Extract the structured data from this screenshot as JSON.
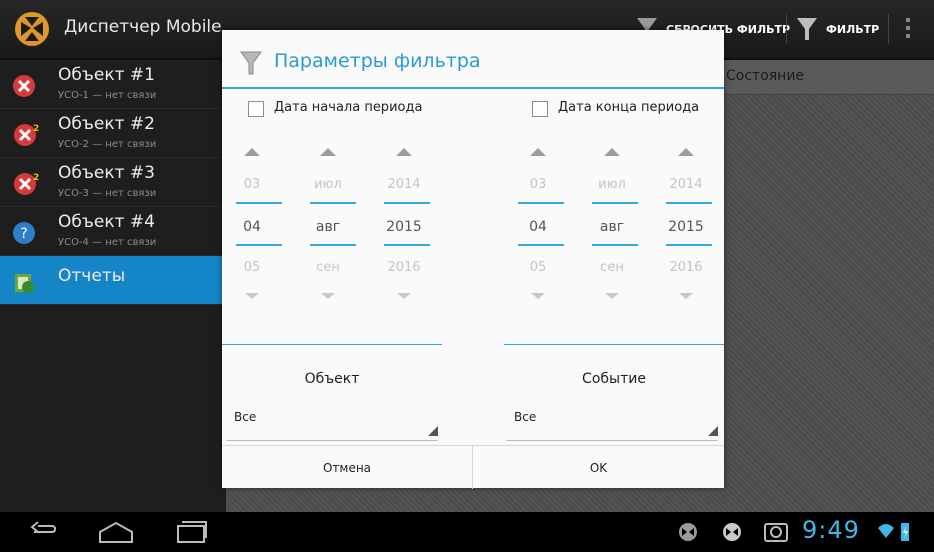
{
  "app": {
    "title": "Диспетчер Mobile"
  },
  "actionbar": {
    "reset_filter_label": "СБРОСИТЬ ФИЛЬТР",
    "filter_label": "ФИЛЬТР"
  },
  "list": [
    {
      "title": "Объект #1",
      "sub": "УСО-1 — нет связи",
      "icon": "error-icon"
    },
    {
      "title": "Объект #2",
      "sub": "УСО-2 — нет связи",
      "icon": "error-icon",
      "badge": "2"
    },
    {
      "title": "Объект #3",
      "sub": "УСО-3 — нет связи",
      "icon": "error-icon",
      "badge": "2"
    },
    {
      "title": "Объект #4",
      "sub": "УСО-4 — нет связи",
      "icon": "help-icon"
    },
    {
      "title": "Отчеты",
      "sub": "",
      "icon": "reports-icon",
      "selected": true
    }
  ],
  "right": {
    "header_text": "Состояние"
  },
  "dialog": {
    "title": "Параметры фильтра",
    "start": {
      "label": "Дата начала периода",
      "checked": false,
      "day": {
        "prev": "03",
        "cur": "04",
        "next": "05"
      },
      "month": {
        "prev": "июл",
        "cur": "авг",
        "next": "сен"
      },
      "year": {
        "prev": "2014",
        "cur": "2015",
        "next": "2016"
      }
    },
    "end": {
      "label": "Дата конца периода",
      "checked": false,
      "day": {
        "prev": "03",
        "cur": "04",
        "next": "05"
      },
      "month": {
        "prev": "июл",
        "cur": "авг",
        "next": "сен"
      },
      "year": {
        "prev": "2014",
        "cur": "2015",
        "next": "2016"
      }
    },
    "object": {
      "title": "Объект",
      "value": "Все"
    },
    "event": {
      "title": "Событие",
      "value": "Все"
    },
    "cancel_label": "Отмена",
    "ok_label": "OK"
  },
  "status": {
    "clock": "9:49"
  },
  "colors": {
    "accent": "#31a7de",
    "selected": "#1486c8",
    "error": "#d63a3a"
  }
}
